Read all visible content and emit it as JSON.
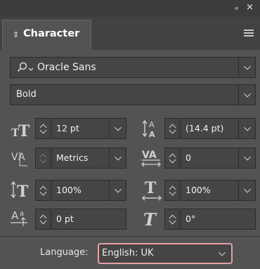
{
  "panel": {
    "collapse_glyph": "«",
    "close_glyph": "×",
    "tab_icon_glyph": "⇕",
    "tab_label": "Character"
  },
  "font": {
    "family": "Oracle Sans",
    "style": "Bold"
  },
  "metrics": {
    "font_size": "12 pt",
    "leading": "(14.4 pt)",
    "kerning": "Metrics",
    "tracking": "0",
    "vertical_scale": "100%",
    "horizontal_scale": "100%",
    "baseline_shift": "0 pt",
    "skew": "0°"
  },
  "language": {
    "label": "Language:",
    "value": "English: UK"
  },
  "colors": {
    "panel_bg": "#535353",
    "field_bg": "#454545",
    "highlight": "#e8a0a8"
  }
}
